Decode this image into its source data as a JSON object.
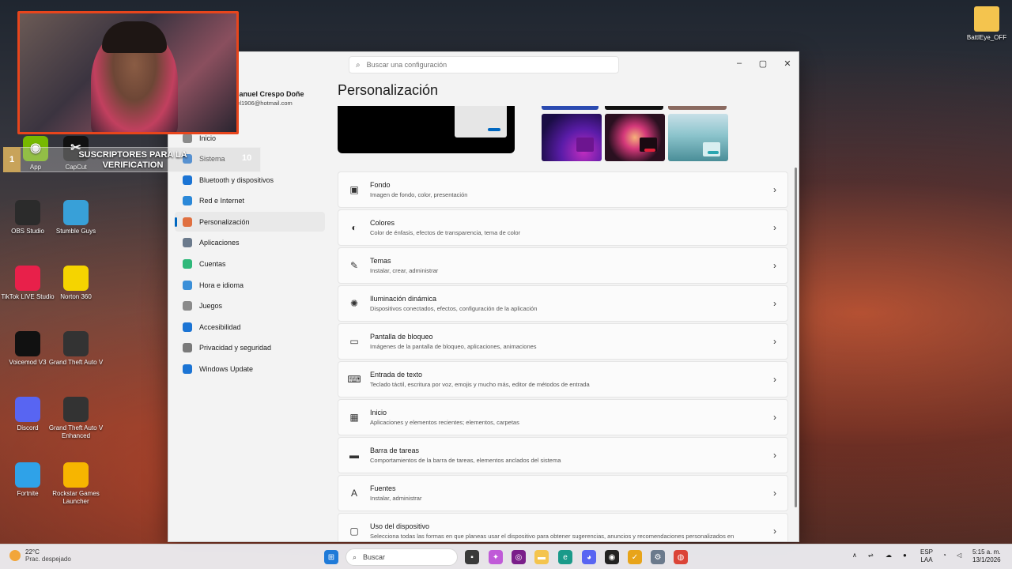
{
  "desktop": {
    "icons_left": [
      {
        "label": "OBS Studio",
        "icon": "obs-icon",
        "color": "#2b2b2b"
      },
      {
        "label": "Stumble Guys",
        "icon": "stumble-guys-icon",
        "color": "#38a0d8"
      },
      {
        "label": "TikTok LIVE Studio",
        "icon": "tiktok-icon",
        "color": "#e8204a"
      },
      {
        "label": "Norton 360",
        "icon": "norton-icon",
        "color": "#f5d400"
      },
      {
        "label": "Voicemod V3",
        "icon": "voicemod-icon",
        "color": "#111111"
      },
      {
        "label": "Grand Theft Auto V",
        "icon": "gta-icon",
        "color": "#333333"
      },
      {
        "label": "Discord",
        "icon": "discord-icon",
        "color": "#5865f2"
      },
      {
        "label": "Grand Theft Auto V Enhanced",
        "icon": "gta-enhanced-icon",
        "color": "#333333"
      },
      {
        "label": "Fortnite",
        "icon": "fortnite-icon",
        "color": "#2fa2e8"
      },
      {
        "label": "Rockstar Games Launcher",
        "icon": "rockstar-icon",
        "color": "#f7b500"
      }
    ],
    "icon_capcut": "CapCut",
    "icon_app": "App",
    "icon_right": "BattlEye_OFF"
  },
  "overlay": {
    "banner_text": "SUSCRIPTORES PARA LA VERIFICATION",
    "num_left": "1",
    "num_right": "10"
  },
  "settings": {
    "search_placeholder": "Buscar una configuración",
    "user_name": "Manuel Crespo Doñe",
    "user_email": "uel1906@hotmail.com",
    "page_title": "Personalización",
    "nav": [
      {
        "label": "Inicio",
        "icon": "home-icon",
        "color": "#8a8a8a"
      },
      {
        "label": "Sistema",
        "icon": "system-icon",
        "color": "#1b74d4"
      },
      {
        "label": "Bluetooth y dispositivos",
        "icon": "bluetooth-icon",
        "color": "#1b74d4"
      },
      {
        "label": "Red e Internet",
        "icon": "network-icon",
        "color": "#2b88d8"
      },
      {
        "label": "Personalización",
        "icon": "brush-icon",
        "color": "#e07040"
      },
      {
        "label": "Aplicaciones",
        "icon": "apps-icon",
        "color": "#6b7a8c"
      },
      {
        "label": "Cuentas",
        "icon": "account-icon",
        "color": "#2fb87a"
      },
      {
        "label": "Hora e idioma",
        "icon": "clock-globe-icon",
        "color": "#3a8fd8"
      },
      {
        "label": "Juegos",
        "icon": "gamepad-icon",
        "color": "#8a8a8a"
      },
      {
        "label": "Accesibilidad",
        "icon": "accessibility-icon",
        "color": "#1b74d4"
      },
      {
        "label": "Privacidad y seguridad",
        "icon": "shield-icon",
        "color": "#7a7a7a"
      },
      {
        "label": "Windows Update",
        "icon": "update-icon",
        "color": "#1b74d4"
      }
    ],
    "cards": [
      {
        "title": "Fondo",
        "desc": "Imagen de fondo, color, presentación",
        "icon": "image-icon",
        "glyph": "▣"
      },
      {
        "title": "Colores",
        "desc": "Color de énfasis, efectos de transparencia, tema de color",
        "icon": "palette-icon",
        "glyph": "◐"
      },
      {
        "title": "Temas",
        "desc": "Instalar, crear, administrar",
        "icon": "pen-icon",
        "glyph": "✎"
      },
      {
        "title": "Iluminación dinámica",
        "desc": "Dispositivos conectados, efectos, configuración de la aplicación",
        "icon": "lighting-icon",
        "glyph": "✺"
      },
      {
        "title": "Pantalla de bloqueo",
        "desc": "Imágenes de la pantalla de bloqueo, aplicaciones, animaciones",
        "icon": "lock-screen-icon",
        "glyph": "▭"
      },
      {
        "title": "Entrada de texto",
        "desc": "Teclado táctil, escritura por voz, emojis y mucho más, editor de métodos de entrada",
        "icon": "keyboard-icon",
        "glyph": "⌨"
      },
      {
        "title": "Inicio",
        "desc": "Aplicaciones y elementos recientes; elementos, carpetas",
        "icon": "start-icon",
        "glyph": "▦"
      },
      {
        "title": "Barra de tareas",
        "desc": "Comportamientos de la barra de tareas, elementos anclados del sistema",
        "icon": "taskbar-icon",
        "glyph": "▬"
      },
      {
        "title": "Fuentes",
        "desc": "Instalar, administrar",
        "icon": "font-icon",
        "glyph": "A"
      },
      {
        "title": "Uso del dispositivo",
        "desc": "Selecciona todas las formas en que planeas usar el dispositivo para obtener sugerencias, anuncios y recomendaciones personalizados en",
        "icon": "device-usage-icon",
        "glyph": "▢"
      }
    ]
  },
  "taskbar": {
    "temperature": "22°C",
    "weather_desc": "Prac. despejado",
    "search_label": "Buscar",
    "lang_top": "ESP",
    "lang_bottom": "LAA",
    "time": "5:15 a. m.",
    "date": "13/1/2026"
  }
}
